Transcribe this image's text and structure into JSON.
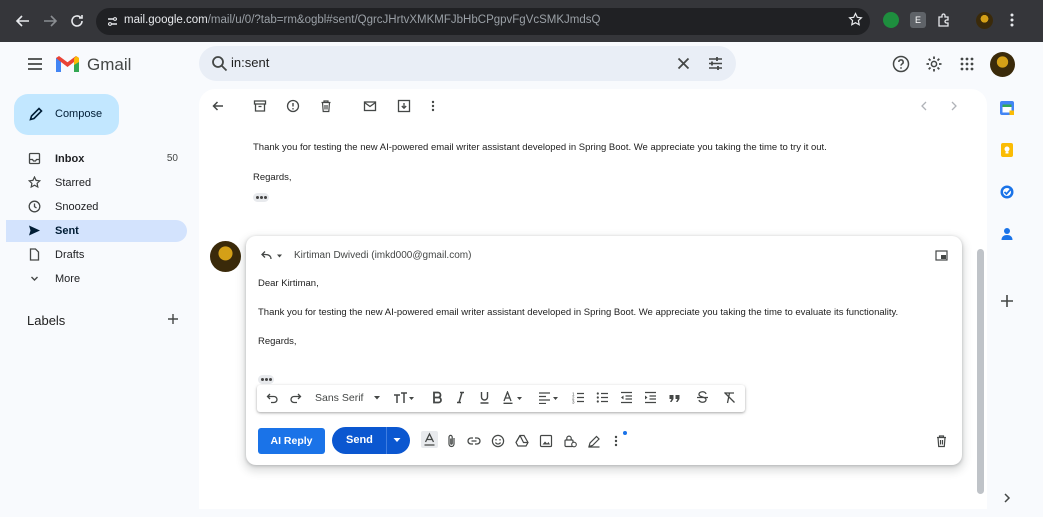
{
  "browser": {
    "url_host": "mail.google.com",
    "url_path": "/mail/u/0/?tab=rm&ogbl#sent/QgrcJHrtvXMKMFJbHbCPgpvFgVcSMKJmdsQ"
  },
  "app": {
    "name": "Gmail"
  },
  "search": {
    "value": "in:sent"
  },
  "colors": {
    "compose_bg": "#c2e7ff",
    "active_nav": "#d3e3fd",
    "send": "#0b57d0",
    "ai_reply": "#1a73e8"
  },
  "sidebar": {
    "compose_label": "Compose",
    "items": [
      {
        "label": "Inbox",
        "count": "50",
        "icon": "inbox-icon"
      },
      {
        "label": "Starred",
        "count": "",
        "icon": "star-icon"
      },
      {
        "label": "Snoozed",
        "count": "",
        "icon": "clock-icon"
      },
      {
        "label": "Sent",
        "count": "",
        "icon": "send-icon"
      },
      {
        "label": "Drafts",
        "count": "",
        "icon": "draft-icon"
      },
      {
        "label": "More",
        "count": "",
        "icon": "chevron-down-icon"
      }
    ],
    "labels_title": "Labels"
  },
  "thread": {
    "previous_message": {
      "body": "Thank you for testing the new AI-powered email writer assistant developed in Spring Boot. We appreciate you taking the time to try it out.",
      "signoff": "Regards,"
    },
    "reply": {
      "recipient": "Kirtiman Dwivedi (imkd000@gmail.com)",
      "greeting": "Dear Kirtiman,",
      "body": "Thank you for testing the new AI-powered email writer assistant developed in Spring Boot. We appreciate you taking the time to evaluate its functionality.",
      "signoff": "Regards,"
    }
  },
  "compose_toolbar": {
    "font": "Sans Serif",
    "ai_reply_label": "AI Reply",
    "send_label": "Send"
  }
}
